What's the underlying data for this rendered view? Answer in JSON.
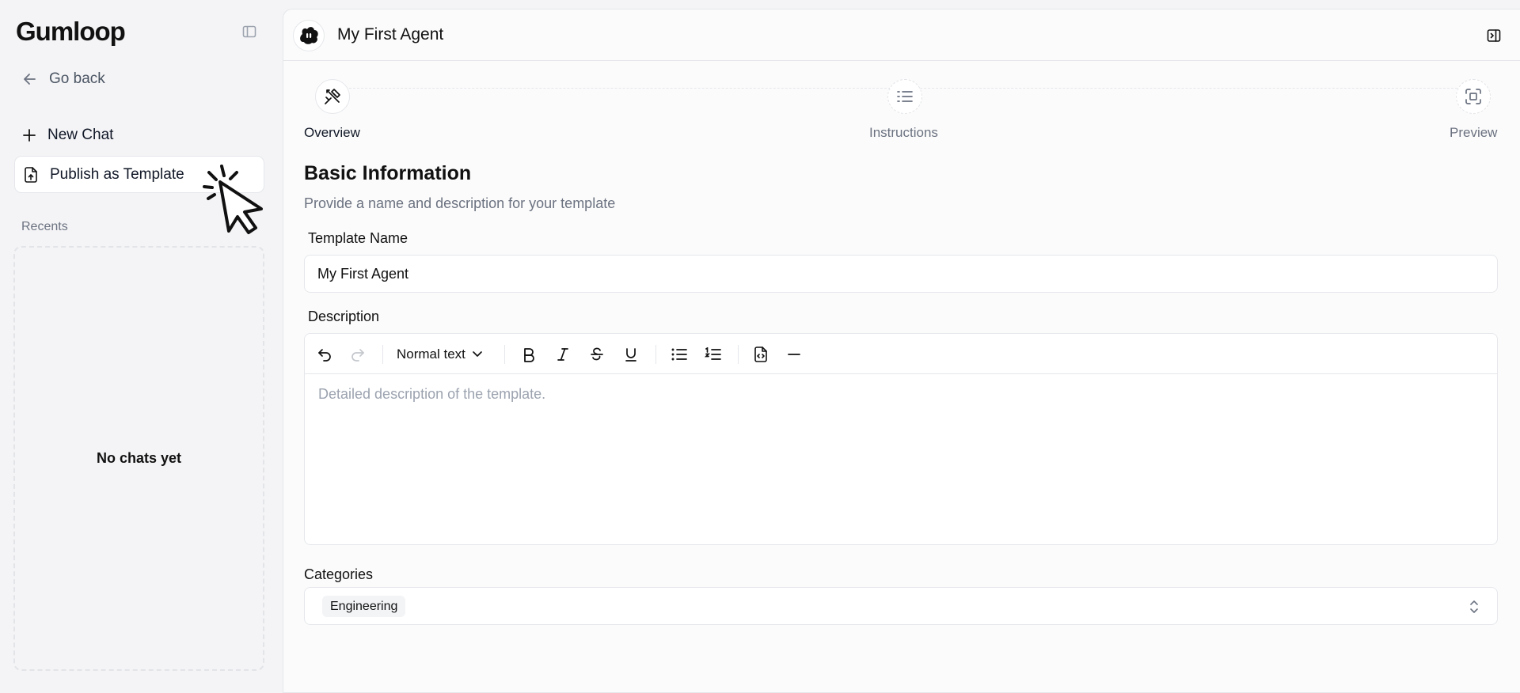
{
  "sidebar": {
    "logo": "Gumloop",
    "go_back": "Go back",
    "new_chat": "New Chat",
    "publish_template": "Publish as Template",
    "recents_label": "Recents",
    "empty_state": "No chats yet"
  },
  "header": {
    "title": "My First Agent"
  },
  "stepper": {
    "steps": [
      {
        "label": "Overview",
        "icon": "wand-pencil-icon",
        "active": true
      },
      {
        "label": "Instructions",
        "icon": "list-icon",
        "active": false
      },
      {
        "label": "Preview",
        "icon": "scan-icon",
        "active": false
      }
    ]
  },
  "form": {
    "title": "Basic Information",
    "subtitle": "Provide a name and description for your template",
    "template_name_label": "Template Name",
    "template_name_value": "My First Agent",
    "description_label": "Description",
    "description_placeholder": "Detailed description of the template.",
    "text_style": "Normal text",
    "categories_label": "Categories",
    "category_chip": "Engineering"
  },
  "colors": {
    "accent": "#111827",
    "muted": "#6b7280",
    "border": "#e5e7eb"
  }
}
